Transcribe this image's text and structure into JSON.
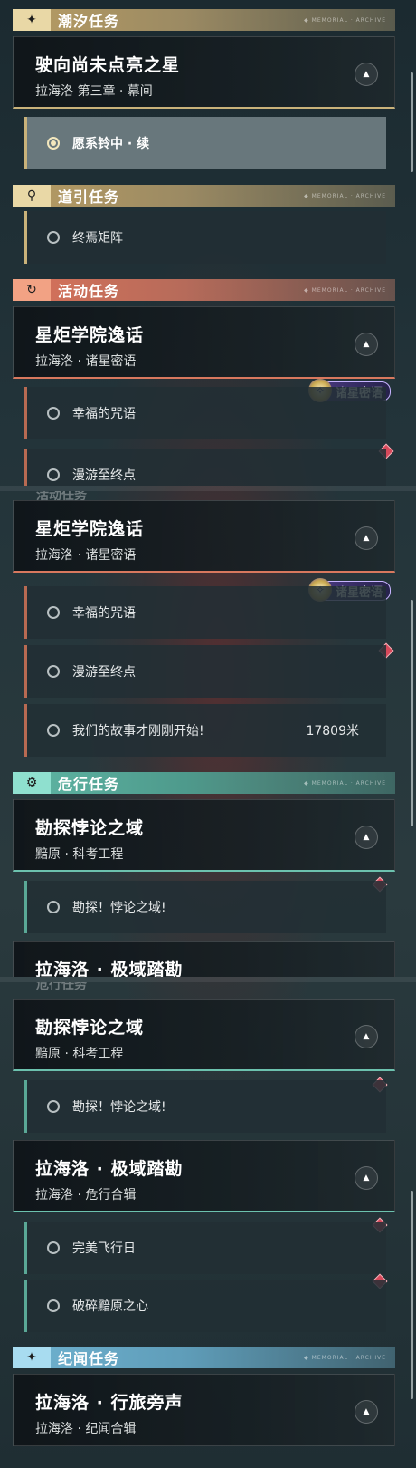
{
  "sections": {
    "tide": {
      "title": "潮汐任务",
      "icon": "four-point-star-icon"
    },
    "guide": {
      "title": "道引任务",
      "icon": "map-pin-icon"
    },
    "event": {
      "title": "活动任务",
      "icon": "cycle-arrow-icon"
    },
    "danger": {
      "title": "危行任务",
      "icon": "gear-icon"
    },
    "lore": {
      "title": "纪闻任务",
      "icon": "four-point-star-icon"
    },
    "header_deco": "◆ MEMORIAL · ARCHIVE"
  },
  "quests": {
    "star": {
      "title": "驶向尚未点亮之星",
      "subtitle": "拉海洛 第三章 · 幕间"
    },
    "academy": {
      "title": "星炬学院逸话",
      "subtitle": "拉海洛 · 诸星密语",
      "tag": "诸星密语"
    },
    "explore": {
      "title": "勘探悖论之域",
      "subtitle": "黯原 · 科考工程"
    },
    "polar": {
      "title": "拉海洛 · 极域踏勘",
      "subtitle": "拉海洛 · 危行合辑"
    },
    "travel": {
      "title": "拉海洛 · 行旅旁声",
      "subtitle": "拉海洛 · 纪闻合辑"
    }
  },
  "steps": {
    "bell": "愿系铃中 · 续",
    "matrix": "终焉矩阵",
    "spell": "幸福的咒语",
    "wander": "漫游至终点",
    "story": "我们的故事才刚刚开始!",
    "story_distance": "17809米",
    "explore_step": "勘探！悖论之域!",
    "flight": "完美飞行日",
    "break": "破碎黯原之心"
  },
  "partial": {
    "wander_cut": "漫游至终点",
    "event_cut": "活动任务",
    "polar_cut": "拉海洛 · 极域踏勘",
    "danger_cut": "危行任务"
  },
  "colors": {
    "gold": "#c9b27a",
    "orange": "#d8785e",
    "teal": "#6cc2ae",
    "blue": "#6fb2d0",
    "marker": "#d8495b"
  }
}
